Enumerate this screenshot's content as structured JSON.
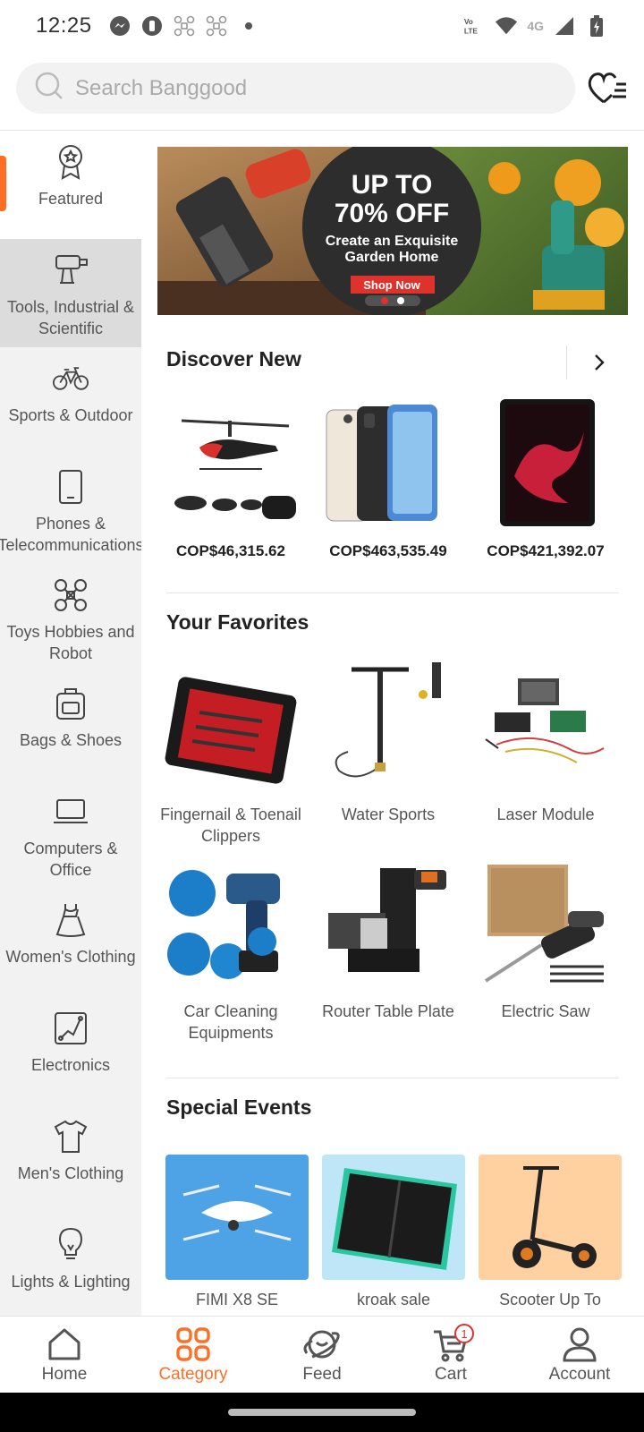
{
  "status_bar": {
    "time": "12:25",
    "network": "4G"
  },
  "search": {
    "placeholder": "Search Banggood"
  },
  "sidebar": {
    "items": [
      {
        "label": "Featured",
        "icon": "star-badge-icon"
      },
      {
        "label": "Tools, Industrial & Scientific",
        "icon": "drill-icon"
      },
      {
        "label": "Sports & Outdoor",
        "icon": "bicycle-icon"
      },
      {
        "label": "Phones & Telecommunications",
        "icon": "phone-icon"
      },
      {
        "label": "Toys Hobbies and Robot",
        "icon": "drone-icon"
      },
      {
        "label": "Bags & Shoes",
        "icon": "bag-icon"
      },
      {
        "label": "Computers & Office",
        "icon": "laptop-icon"
      },
      {
        "label": "Women's Clothing",
        "icon": "dress-icon"
      },
      {
        "label": "Electronics",
        "icon": "circuit-icon"
      },
      {
        "label": "Men's Clothing",
        "icon": "tshirt-icon"
      },
      {
        "label": "Lights & Lighting",
        "icon": "bulb-icon"
      }
    ]
  },
  "banner": {
    "headline1": "UP TO",
    "headline2": "70% OFF",
    "subline1": "Create an Exquisite",
    "subline2": "Garden Home",
    "cta": "Shop Now"
  },
  "discover_new": {
    "title": "Discover New",
    "products": [
      {
        "price": "COP$46,315.62"
      },
      {
        "price": "COP$463,535.49"
      },
      {
        "price": "COP$421,392.07"
      }
    ]
  },
  "favorites": {
    "title": "Your Favorites",
    "items": [
      {
        "name": "Fingernail & Toenail Clippers"
      },
      {
        "name": "Water Sports"
      },
      {
        "name": "Laser Module"
      },
      {
        "name": "Car Cleaning Equipments"
      },
      {
        "name": "Router Table Plate"
      },
      {
        "name": "Electric Saw"
      }
    ]
  },
  "special_events": {
    "title": "Special Events",
    "items": [
      {
        "name": "FIMI X8 SE",
        "bg": "#4ea3e6"
      },
      {
        "name": "kroak sale",
        "bg": "#bfe6f7"
      },
      {
        "name": "Scooter Up To",
        "bg": "#ffd0a0"
      }
    ]
  },
  "bottom_nav": {
    "items": [
      {
        "label": "Home"
      },
      {
        "label": "Category"
      },
      {
        "label": "Feed"
      },
      {
        "label": "Cart"
      },
      {
        "label": "Account"
      }
    ],
    "cart_count": "1"
  },
  "colors": {
    "accent": "#ff6e26",
    "badge": "#e0322d"
  }
}
